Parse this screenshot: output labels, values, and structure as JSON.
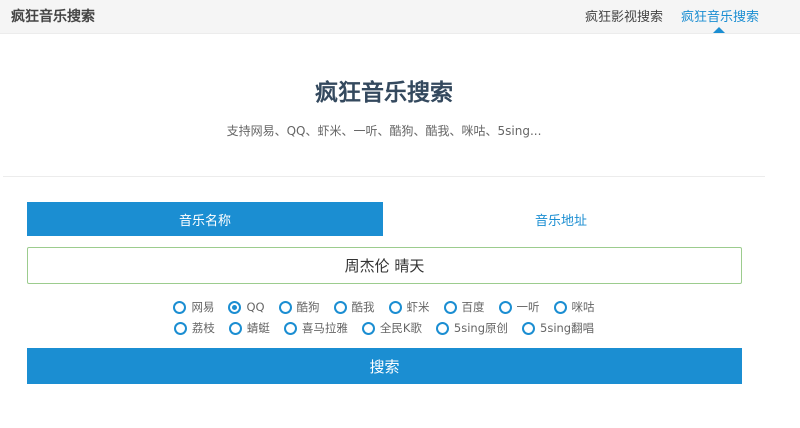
{
  "header": {
    "brand": "疯狂音乐搜索",
    "nav": [
      {
        "label": "疯狂影视搜索",
        "active": false
      },
      {
        "label": "疯狂音乐搜索",
        "active": true
      }
    ]
  },
  "hero": {
    "title": "疯狂音乐搜索",
    "subtitle": "支持网易、QQ、虾米、一听、酷狗、酷我、咪咕、5sing..."
  },
  "tabs": [
    {
      "label": "音乐名称",
      "active": true
    },
    {
      "label": "音乐地址",
      "active": false
    }
  ],
  "search": {
    "value": "周杰伦 晴天",
    "button_label": "搜索"
  },
  "sources": {
    "selected": "QQ",
    "row1": [
      "网易",
      "QQ",
      "酷狗",
      "酷我",
      "虾米",
      "百度",
      "一听",
      "咪咕"
    ],
    "row2": [
      "荔枝",
      "蜻蜓",
      "喜马拉雅",
      "全民K歌",
      "5sing原创",
      "5sing翻唱"
    ]
  },
  "colors": {
    "accent": "#1b8ed2",
    "input_border": "#9ccc8e",
    "title": "#34495e"
  }
}
